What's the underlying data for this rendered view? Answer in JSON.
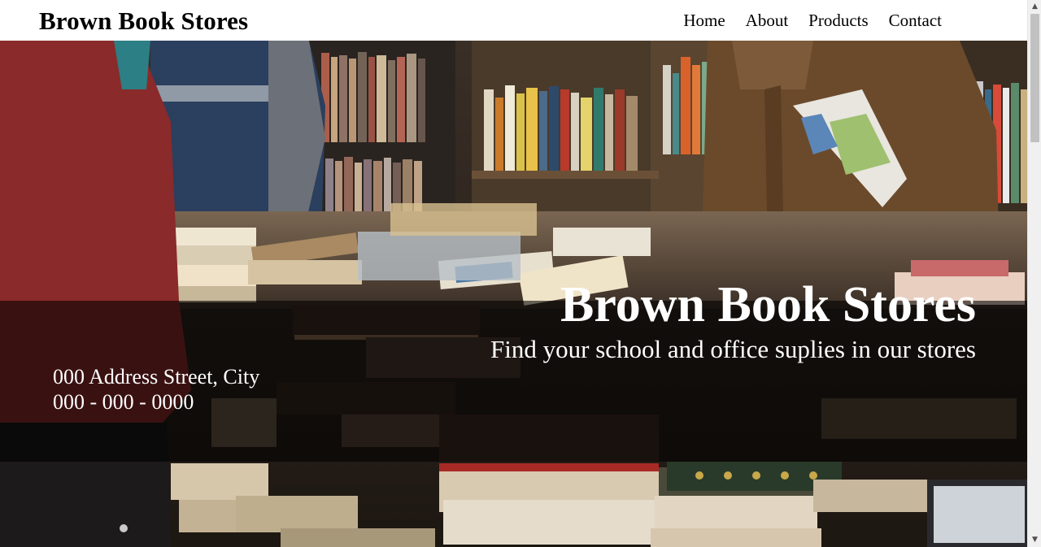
{
  "header": {
    "brand": "Brown Book Stores",
    "nav": [
      {
        "label": "Home"
      },
      {
        "label": "About"
      },
      {
        "label": "Products"
      },
      {
        "label": "Contact"
      }
    ]
  },
  "hero": {
    "title": "Brown Book Stores",
    "subtitle": "Find your school and office suplies in our stores",
    "address_line": "000 Address Street, City",
    "phone_line": "000 - 000 - 0000",
    "background_image": "bookstore-photo"
  },
  "colors": {
    "header_bg": "#ffffff",
    "band_overlay": "rgba(0,0,0,0.58)",
    "hero_text": "#ffffff"
  },
  "scrollbar": {
    "up_arrow": "▲",
    "down_arrow": "▼"
  }
}
